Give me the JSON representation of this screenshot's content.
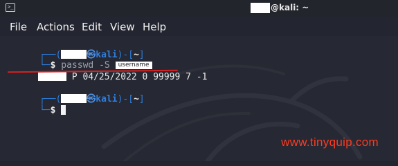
{
  "window": {
    "title_suffix": "@kali: ~",
    "icon": "terminal-icon"
  },
  "menu": [
    "File",
    "Actions",
    "Edit",
    "View",
    "Help"
  ],
  "terminal": {
    "prompt1": {
      "open": "┌──(",
      "host": "kali",
      "close": ")-[",
      "dir": "~",
      "end": "]"
    },
    "prompt1_cont": "└─",
    "dollar": "$",
    "command": "passwd -S",
    "username_tag": "username",
    "output_fields": "P 04/25/2022 0 99999 7 -1",
    "prompt2": {
      "open": "┌──(",
      "host": "kali",
      "close": ")-[",
      "dir": "~",
      "end": "]"
    },
    "prompt2_cont": "└─",
    "dollar2": "$"
  },
  "watermark": "www.tinyquip.com",
  "colors": {
    "prompt_blue": "#2f7fdd",
    "annotation_red": "#d8201f",
    "watermark_red": "#ff3b1f"
  }
}
